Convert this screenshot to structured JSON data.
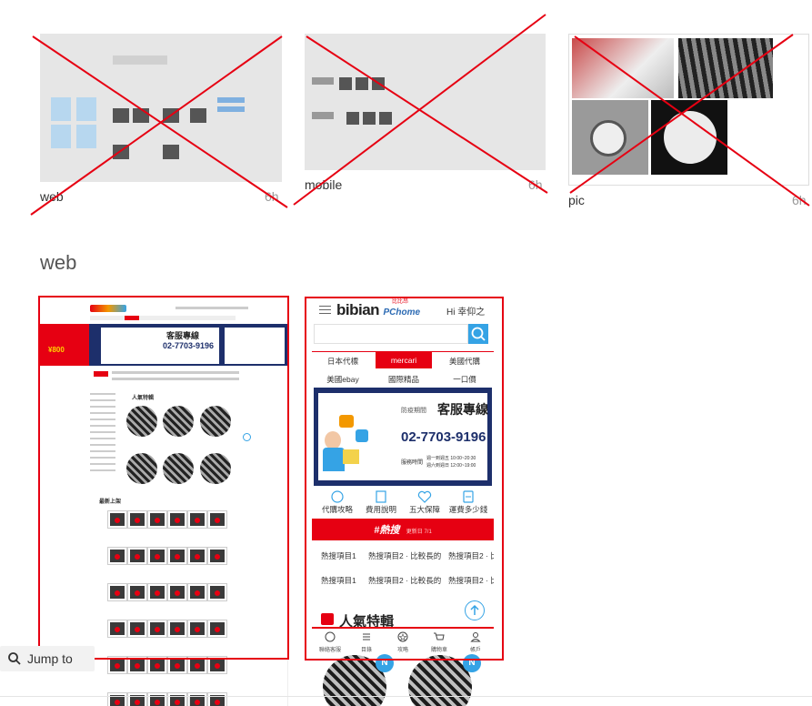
{
  "thumbnails": [
    {
      "label": "web",
      "age": "6h"
    },
    {
      "label": "mobile",
      "age": "6h"
    },
    {
      "label": "pic",
      "age": "6h"
    }
  ],
  "section_title": "web",
  "mobile_preview": {
    "menu_icon": "hamburger-icon",
    "logo_main": "bibian",
    "logo_sub": "PChome",
    "logo_tag": "比比昂",
    "greeting": "Hi 幸仰之",
    "search_icon": "search-icon",
    "tabs_row1": [
      "日本代標",
      "mercari",
      "美國代購"
    ],
    "tabs_row2": [
      "美國ebay",
      "國際精品",
      "一口價"
    ],
    "banner": {
      "hours_caption": "防疫期間",
      "hotline_label": "客服專線",
      "phone": "02-7703-9196",
      "service_label": "服務時間",
      "weekday_hours": "週一到週五 10:00~20:30",
      "weekend_hours": "週六到週日 12:00~19:00"
    },
    "feature_icons": [
      {
        "label": "代購攻略",
        "icon": "badge-icon"
      },
      {
        "label": "費用說明",
        "icon": "document-icon"
      },
      {
        "label": "五大保障",
        "icon": "heart-shield-icon"
      },
      {
        "label": "運費多少錢",
        "icon": "calculator-icon"
      }
    ],
    "hot_title": "#熱搜",
    "hot_update": "更新日 7/1",
    "hot_items_row1": [
      "熱搜項目1",
      "熱搜項目2 · 比較長的",
      "熱搜項目2 · 比"
    ],
    "hot_items_row2": [
      "熱搜項目1",
      "熱搜項目2 · 比較長的",
      "熱搜項目2 · 比"
    ],
    "popular_title": "人氣特輯",
    "bottom_nav": [
      {
        "label": "聯絡客服",
        "icon": "chat-icon"
      },
      {
        "label": "目錄",
        "icon": "list-icon"
      },
      {
        "label": "攻略",
        "icon": "star-badge-icon"
      },
      {
        "label": "購物車",
        "icon": "cart-icon"
      },
      {
        "label": "帳戶",
        "icon": "user-icon"
      }
    ],
    "circle_badge": "N"
  },
  "web_preview": {
    "phone": "02-7703-9196",
    "hotline_label": "客服專線",
    "promo_amount": "¥800",
    "popular_title": "人氣特輯",
    "latest_title": "最新上架"
  },
  "jump_to": {
    "label": "Jump to",
    "icon": "search-icon"
  },
  "colors": {
    "brand_red": "#e60012",
    "accent_blue": "#35a3e5",
    "navy": "#1d2f6b"
  }
}
